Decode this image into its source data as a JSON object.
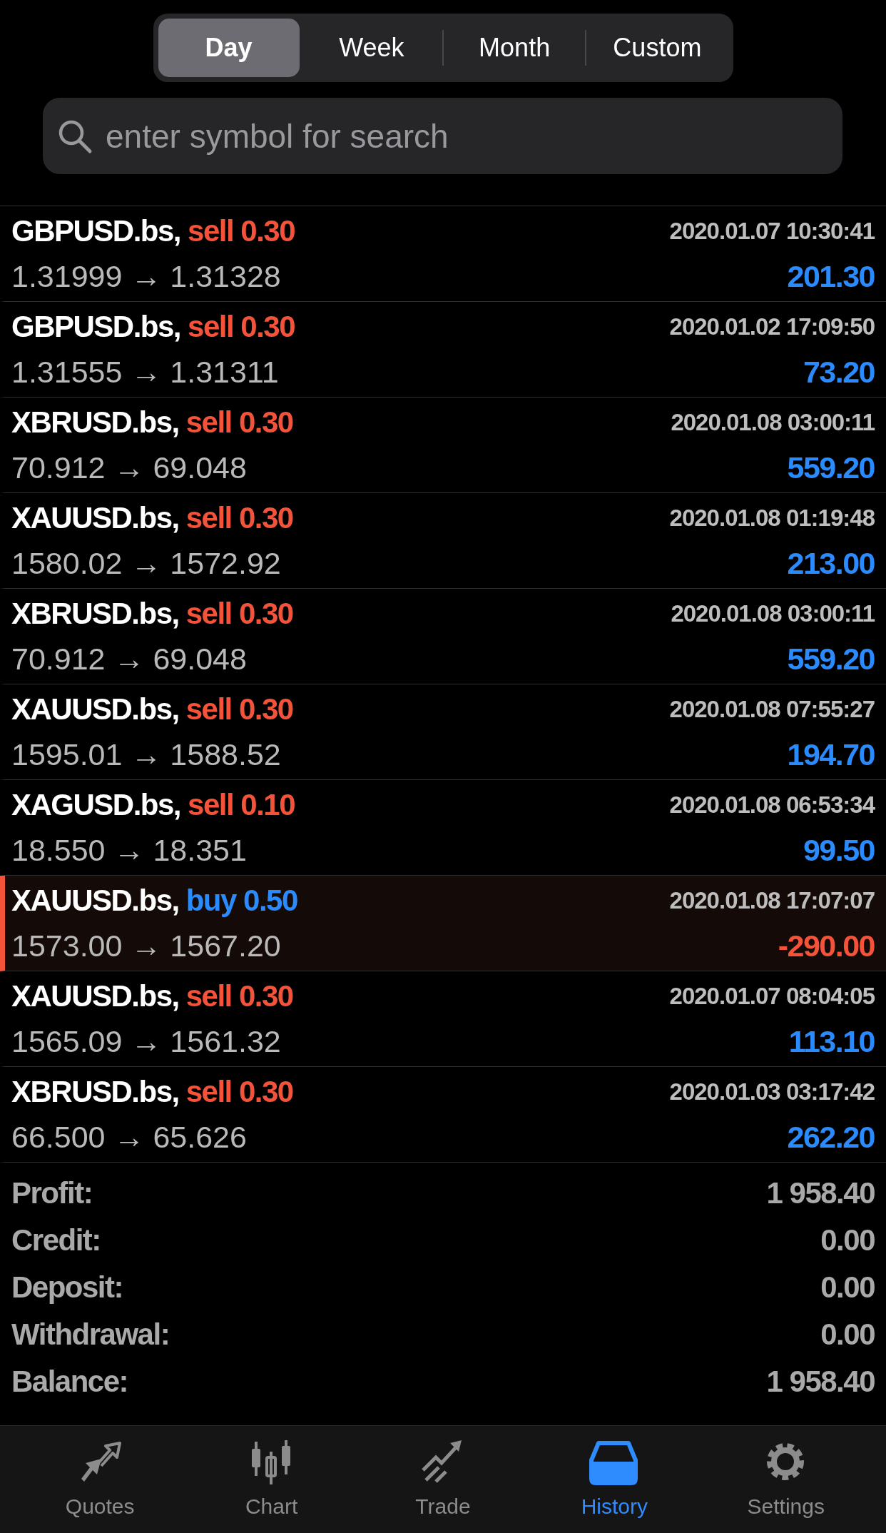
{
  "periods": [
    {
      "label": "Day",
      "selected": true
    },
    {
      "label": "Week",
      "selected": false
    },
    {
      "label": "Month",
      "selected": false
    },
    {
      "label": "Custom",
      "selected": false
    }
  ],
  "search": {
    "placeholder": "enter symbol for search"
  },
  "deals": [
    {
      "symbol": "GBPUSD.bs,",
      "kind": "sell",
      "action": "sell 0.30",
      "time": "2020.01.07 10:30:41",
      "prices": "1.31999 → 1.31328",
      "profit": "201.30",
      "loss": false,
      "highlighted": false
    },
    {
      "symbol": "GBPUSD.bs,",
      "kind": "sell",
      "action": "sell 0.30",
      "time": "2020.01.02 17:09:50",
      "prices": "1.31555 → 1.31311",
      "profit": "73.20",
      "loss": false,
      "highlighted": false
    },
    {
      "symbol": "XBRUSD.bs,",
      "kind": "sell",
      "action": "sell 0.30",
      "time": "2020.01.08 03:00:11",
      "prices": "70.912 → 69.048",
      "profit": "559.20",
      "loss": false,
      "highlighted": false
    },
    {
      "symbol": "XAUUSD.bs,",
      "kind": "sell",
      "action": "sell 0.30",
      "time": "2020.01.08 01:19:48",
      "prices": "1580.02 → 1572.92",
      "profit": "213.00",
      "loss": false,
      "highlighted": false
    },
    {
      "symbol": "XBRUSD.bs,",
      "kind": "sell",
      "action": "sell 0.30",
      "time": "2020.01.08 03:00:11",
      "prices": "70.912 → 69.048",
      "profit": "559.20",
      "loss": false,
      "highlighted": false
    },
    {
      "symbol": "XAUUSD.bs,",
      "kind": "sell",
      "action": "sell 0.30",
      "time": "2020.01.08 07:55:27",
      "prices": "1595.01 → 1588.52",
      "profit": "194.70",
      "loss": false,
      "highlighted": false
    },
    {
      "symbol": "XAGUSD.bs,",
      "kind": "sell",
      "action": "sell 0.10",
      "time": "2020.01.08 06:53:34",
      "prices": "18.550 → 18.351",
      "profit": "99.50",
      "loss": false,
      "highlighted": false
    },
    {
      "symbol": "XAUUSD.bs,",
      "kind": "buy",
      "action": "buy 0.50",
      "time": "2020.01.08 17:07:07",
      "prices": "1573.00 → 1567.20",
      "profit": "-290.00",
      "loss": true,
      "highlighted": true
    },
    {
      "symbol": "XAUUSD.bs,",
      "kind": "sell",
      "action": "sell 0.30",
      "time": "2020.01.07 08:04:05",
      "prices": "1565.09 → 1561.32",
      "profit": "113.10",
      "loss": false,
      "highlighted": false
    },
    {
      "symbol": "XBRUSD.bs,",
      "kind": "sell",
      "action": "sell 0.30",
      "time": "2020.01.03 03:17:42",
      "prices": "66.500 → 65.626",
      "profit": "262.20",
      "loss": false,
      "highlighted": false
    }
  ],
  "summary": [
    {
      "label": "Profit:",
      "value": "1 958.40"
    },
    {
      "label": "Credit:",
      "value": "0.00"
    },
    {
      "label": "Deposit:",
      "value": "0.00"
    },
    {
      "label": "Withdrawal:",
      "value": "0.00"
    },
    {
      "label": "Balance:",
      "value": "1 958.40"
    }
  ],
  "tab_bar": [
    {
      "kind": "quotes",
      "label": "Quotes",
      "selected": false
    },
    {
      "kind": "chart",
      "label": "Chart",
      "selected": false
    },
    {
      "kind": "trade",
      "label": "Trade",
      "selected": false
    },
    {
      "kind": "history",
      "label": "History",
      "selected": true
    },
    {
      "kind": "settings",
      "label": "Settings",
      "selected": false
    }
  ]
}
